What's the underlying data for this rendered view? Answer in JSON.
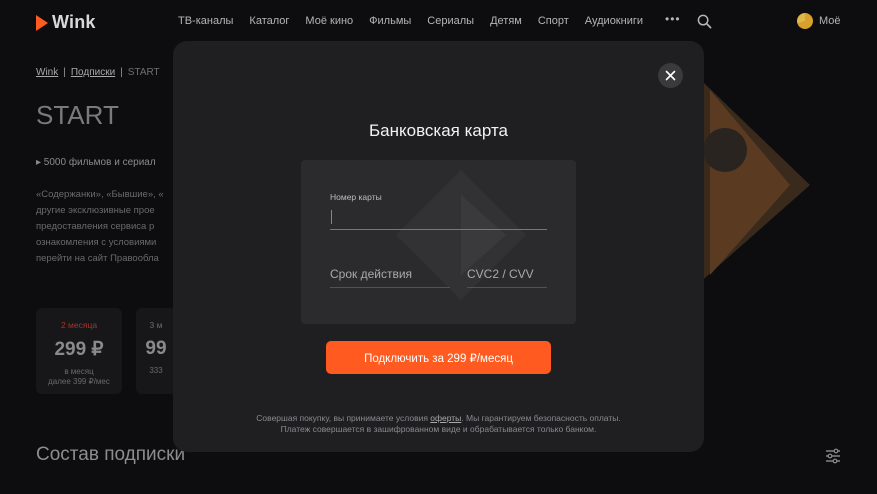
{
  "header": {
    "logo_text": "Wink",
    "nav": [
      "ТВ-каналы",
      "Каталог",
      "Моё кино",
      "Фильмы",
      "Сериалы",
      "Детям",
      "Спорт",
      "Аудиокниги"
    ],
    "more": "•••",
    "profile_label": "Моё"
  },
  "breadcrumb": {
    "home": "Wink",
    "section": "Подписки",
    "current": "START"
  },
  "background": {
    "title": "START",
    "bullet": "▸ 5000 фильмов и сериал",
    "description": "«Содержанки», «Бывшие», «\nдругие эксклюзивные прое\nпредоставления сервиса р\nознакомления с условиями\nперейти на сайт Правообла",
    "plan1": {
      "label": "2 месяца",
      "price": "299 ₽",
      "note": "в месяц\nдалее 399 ₽/мес"
    },
    "plan2": {
      "label": "3 м",
      "price": "99",
      "note": "333"
    },
    "section_title": "Состав подписки"
  },
  "modal": {
    "title": "Банковская карта",
    "card_number_label": "Номер карты",
    "card_number_value": "",
    "expiry_placeholder": "Срок действия",
    "cvc_placeholder": "CVC2 / CVV",
    "submit_label": "Подключить за 299 ₽/месяц",
    "footnote_before": "Совершая покупку, вы принимаете условия ",
    "footnote_link": "оферты",
    "footnote_after": ". Мы гарантируем безопасность оплаты.",
    "footnote_line2": "Платеж совершается в зашифрованном виде и обрабатывается только банком."
  },
  "colors": {
    "accent": "#ff5a1f",
    "modal_bg": "#1f1f22",
    "page_bg": "#0d0d0f"
  }
}
